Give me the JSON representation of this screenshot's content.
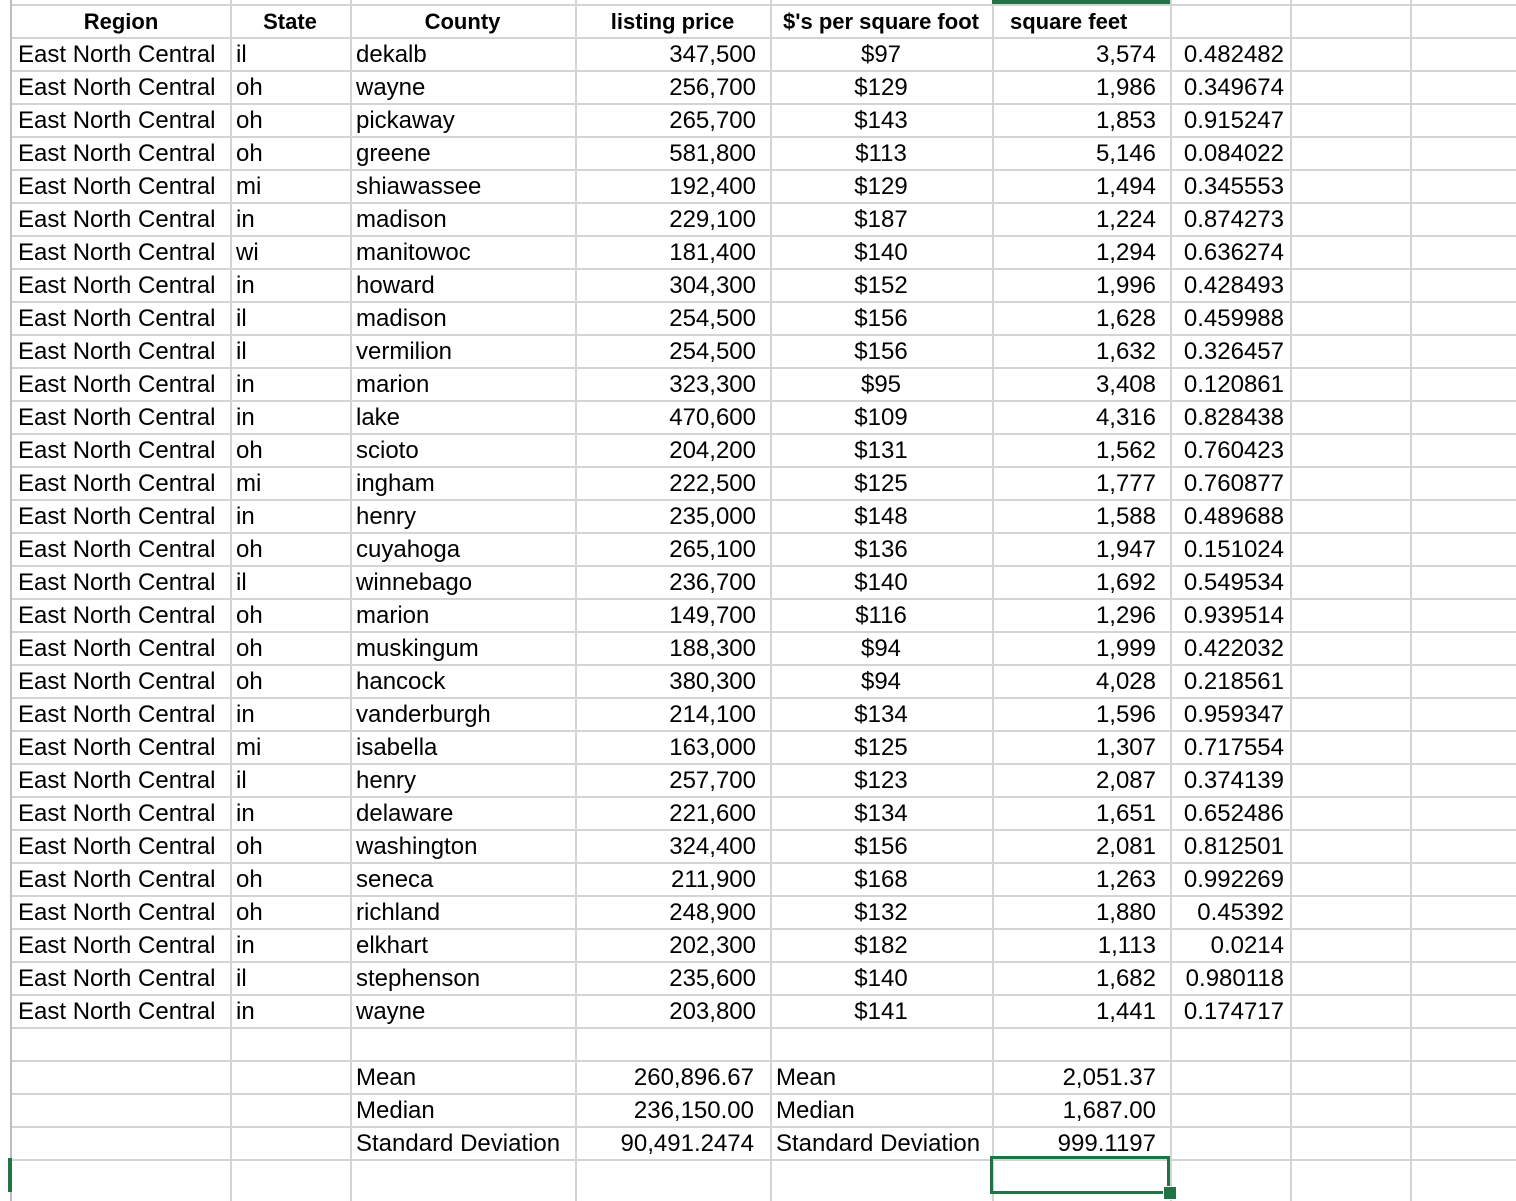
{
  "sheet": {
    "headers": {
      "region": "Region",
      "state": "State",
      "county": "County",
      "listing_price": "listing price",
      "price_per_sqft": "$'s per square foot",
      "square_feet": "square feet"
    },
    "rows": [
      {
        "region": "East North Central",
        "state": "il",
        "county": "dekalb",
        "price": "347,500",
        "ppsf": "$97",
        "sqft": "3,574",
        "rand": "0.482482"
      },
      {
        "region": "East North Central",
        "state": "oh",
        "county": "wayne",
        "price": "256,700",
        "ppsf": "$129",
        "sqft": "1,986",
        "rand": "0.349674"
      },
      {
        "region": "East North Central",
        "state": "oh",
        "county": "pickaway",
        "price": "265,700",
        "ppsf": "$143",
        "sqft": "1,853",
        "rand": "0.915247"
      },
      {
        "region": "East North Central",
        "state": "oh",
        "county": "greene",
        "price": "581,800",
        "ppsf": "$113",
        "sqft": "5,146",
        "rand": "0.084022"
      },
      {
        "region": "East North Central",
        "state": "mi",
        "county": "shiawassee",
        "price": "192,400",
        "ppsf": "$129",
        "sqft": "1,494",
        "rand": "0.345553"
      },
      {
        "region": "East North Central",
        "state": "in",
        "county": "madison",
        "price": "229,100",
        "ppsf": "$187",
        "sqft": "1,224",
        "rand": "0.874273"
      },
      {
        "region": "East North Central",
        "state": "wi",
        "county": "manitowoc",
        "price": "181,400",
        "ppsf": "$140",
        "sqft": "1,294",
        "rand": "0.636274"
      },
      {
        "region": "East North Central",
        "state": "in",
        "county": "howard",
        "price": "304,300",
        "ppsf": "$152",
        "sqft": "1,996",
        "rand": "0.428493"
      },
      {
        "region": "East North Central",
        "state": "il",
        "county": "madison",
        "price": "254,500",
        "ppsf": "$156",
        "sqft": "1,628",
        "rand": "0.459988"
      },
      {
        "region": "East North Central",
        "state": "il",
        "county": "vermilion",
        "price": "254,500",
        "ppsf": "$156",
        "sqft": "1,632",
        "rand": "0.326457"
      },
      {
        "region": "East North Central",
        "state": "in",
        "county": "marion",
        "price": "323,300",
        "ppsf": "$95",
        "sqft": "3,408",
        "rand": "0.120861"
      },
      {
        "region": "East North Central",
        "state": "in",
        "county": "lake",
        "price": "470,600",
        "ppsf": "$109",
        "sqft": "4,316",
        "rand": "0.828438"
      },
      {
        "region": "East North Central",
        "state": "oh",
        "county": "scioto",
        "price": "204,200",
        "ppsf": "$131",
        "sqft": "1,562",
        "rand": "0.760423"
      },
      {
        "region": "East North Central",
        "state": "mi",
        "county": "ingham",
        "price": "222,500",
        "ppsf": "$125",
        "sqft": "1,777",
        "rand": "0.760877"
      },
      {
        "region": "East North Central",
        "state": "in",
        "county": "henry",
        "price": "235,000",
        "ppsf": "$148",
        "sqft": "1,588",
        "rand": "0.489688"
      },
      {
        "region": "East North Central",
        "state": "oh",
        "county": "cuyahoga",
        "price": "265,100",
        "ppsf": "$136",
        "sqft": "1,947",
        "rand": "0.151024"
      },
      {
        "region": "East North Central",
        "state": "il",
        "county": "winnebago",
        "price": "236,700",
        "ppsf": "$140",
        "sqft": "1,692",
        "rand": "0.549534"
      },
      {
        "region": "East North Central",
        "state": "oh",
        "county": "marion",
        "price": "149,700",
        "ppsf": "$116",
        "sqft": "1,296",
        "rand": "0.939514"
      },
      {
        "region": "East North Central",
        "state": "oh",
        "county": "muskingum",
        "price": "188,300",
        "ppsf": "$94",
        "sqft": "1,999",
        "rand": "0.422032"
      },
      {
        "region": "East North Central",
        "state": "oh",
        "county": "hancock",
        "price": "380,300",
        "ppsf": "$94",
        "sqft": "4,028",
        "rand": "0.218561"
      },
      {
        "region": "East North Central",
        "state": "in",
        "county": "vanderburgh",
        "price": "214,100",
        "ppsf": "$134",
        "sqft": "1,596",
        "rand": "0.959347"
      },
      {
        "region": "East North Central",
        "state": "mi",
        "county": "isabella",
        "price": "163,000",
        "ppsf": "$125",
        "sqft": "1,307",
        "rand": "0.717554"
      },
      {
        "region": "East North Central",
        "state": "il",
        "county": "henry",
        "price": "257,700",
        "ppsf": "$123",
        "sqft": "2,087",
        "rand": "0.374139"
      },
      {
        "region": "East North Central",
        "state": "in",
        "county": "delaware",
        "price": "221,600",
        "ppsf": "$134",
        "sqft": "1,651",
        "rand": "0.652486"
      },
      {
        "region": "East North Central",
        "state": "oh",
        "county": "washington",
        "price": "324,400",
        "ppsf": "$156",
        "sqft": "2,081",
        "rand": "0.812501"
      },
      {
        "region": "East North Central",
        "state": "oh",
        "county": "seneca",
        "price": "211,900",
        "ppsf": "$168",
        "sqft": "1,263",
        "rand": "0.992269"
      },
      {
        "region": "East North Central",
        "state": "oh",
        "county": "richland",
        "price": "248,900",
        "ppsf": "$132",
        "sqft": "1,880",
        "rand": "0.45392"
      },
      {
        "region": "East North Central",
        "state": "in",
        "county": "elkhart",
        "price": "202,300",
        "ppsf": "$182",
        "sqft": "1,113",
        "rand": "0.0214"
      },
      {
        "region": "East North Central",
        "state": "il",
        "county": "stephenson",
        "price": "235,600",
        "ppsf": "$140",
        "sqft": "1,682",
        "rand": "0.980118"
      },
      {
        "region": "East North Central",
        "state": "in",
        "county": "wayne",
        "price": "203,800",
        "ppsf": "$141",
        "sqft": "1,441",
        "rand": "0.174717"
      }
    ],
    "stats": [
      {
        "label": "Mean",
        "price": "260,896.67",
        "label2": "Mean",
        "sqft": "2,051.37"
      },
      {
        "label": "Median",
        "price": "236,150.00",
        "label2": "Median",
        "sqft": "1,687.00"
      },
      {
        "label": "Standard Deviation",
        "price": "90,491.2474",
        "label2": "Standard Deviation",
        "sqft": "999.1197"
      }
    ],
    "colors": {
      "gridline": "#d4d4d4",
      "selection": "#217346"
    }
  }
}
